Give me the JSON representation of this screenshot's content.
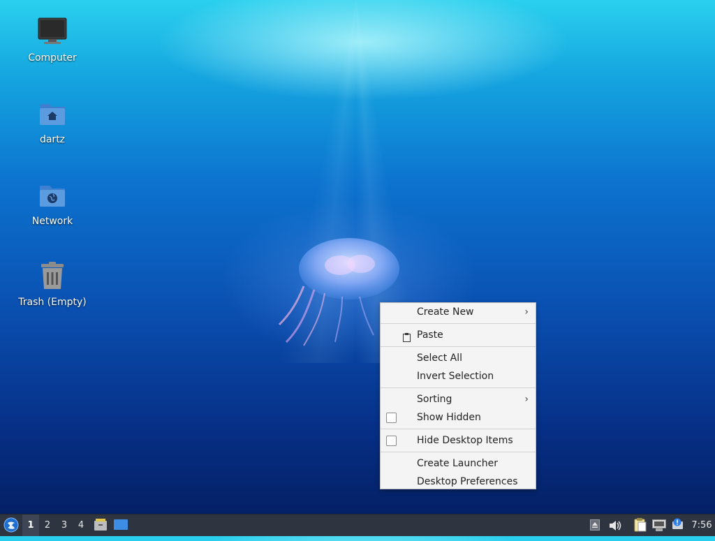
{
  "desktop": {
    "icons": [
      {
        "label": "Computer"
      },
      {
        "label": "dartz"
      },
      {
        "label": "Network"
      },
      {
        "label": "Trash (Empty)"
      }
    ]
  },
  "context_menu": {
    "items": {
      "create_new": "Create New",
      "paste": "Paste",
      "select_all": "Select All",
      "invert_selection": "Invert Selection",
      "sorting": "Sorting",
      "show_hidden": "Show Hidden",
      "hide_desktop_items": "Hide Desktop Items",
      "create_launcher": "Create Launcher",
      "desktop_preferences": "Desktop Preferences"
    },
    "submenu_indicator": "›",
    "checkboxes": {
      "show_hidden": false,
      "hide_desktop_items": false
    }
  },
  "taskbar": {
    "workspaces": [
      "1",
      "2",
      "3",
      "4"
    ],
    "active_workspace": "1",
    "clock": "7:56",
    "launchers": [
      "file-manager-icon",
      "show-desktop-icon"
    ],
    "tray": [
      "eject-icon",
      "volume-icon",
      "clipboard-icon",
      "network-icon",
      "update-notifier-icon"
    ]
  },
  "colors": {
    "taskbar_bg": "#2e3440",
    "menu_bg": "#f4f4f4",
    "folder_blue": "#5b9be0",
    "desktop_top": "#2ad0ee",
    "desktop_bottom": "#041c5c"
  }
}
